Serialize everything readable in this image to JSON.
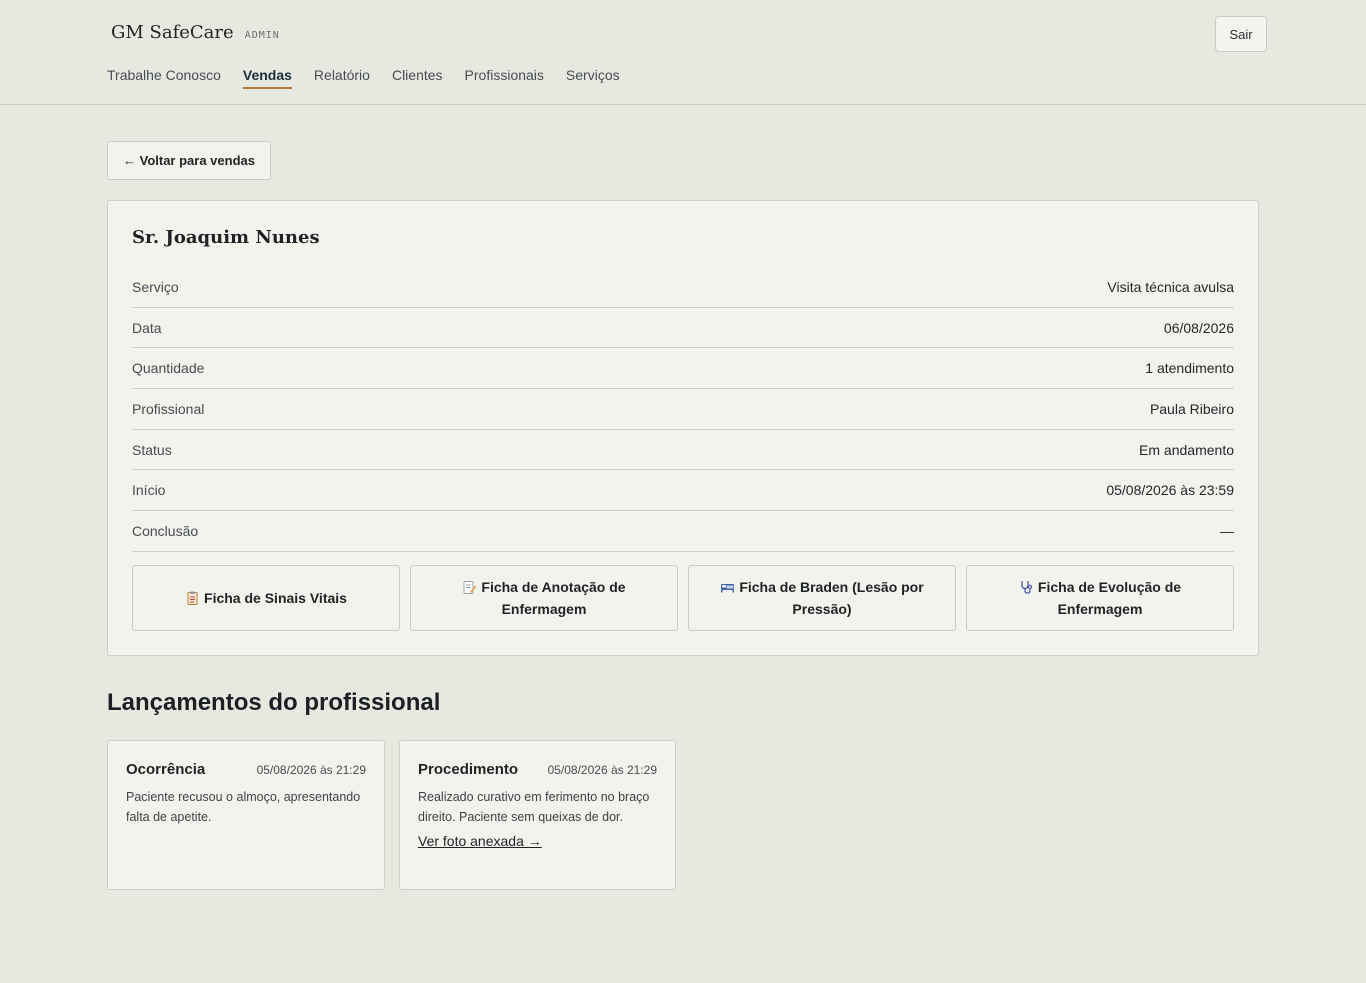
{
  "app": {
    "name": "GM SafeCare",
    "badge": "ADMIN",
    "logout_label": "Sair"
  },
  "nav": {
    "items": [
      {
        "label": "Trabalhe Conosco"
      },
      {
        "label": "Vendas"
      },
      {
        "label": "Relatório"
      },
      {
        "label": "Clientes"
      },
      {
        "label": "Profissionais"
      },
      {
        "label": "Serviços"
      }
    ],
    "active": "Vendas"
  },
  "back_label": "← Voltar para vendas",
  "sale": {
    "client_name": "Sr. Joaquim Nunes",
    "details": [
      {
        "label": "Serviço",
        "value": "Visita técnica avulsa"
      },
      {
        "label": "Data",
        "value": "06/08/2026"
      },
      {
        "label": "Quantidade",
        "value": "1 atendimento"
      },
      {
        "label": "Profissional",
        "value": "Paula Ribeiro"
      },
      {
        "label": "Status",
        "value": "Em andamento"
      },
      {
        "label": "Início",
        "value": "05/08/2026 às 23:59"
      },
      {
        "label": "Conclusão",
        "value": "—"
      }
    ],
    "forms": [
      {
        "label": "Ficha de Sinais Vitais",
        "icon": "clipboard-icon"
      },
      {
        "label": "Ficha de Anotação de Enfermagem",
        "icon": "memo-icon"
      },
      {
        "label": "Ficha de Braden (Lesão por Pressão)",
        "icon": "bed-icon"
      },
      {
        "label": "Ficha de Evolução de Enfermagem",
        "icon": "stethoscope-icon"
      }
    ]
  },
  "entries_section": {
    "title": "Lançamentos do profissional",
    "entries": [
      {
        "type": "Ocorrência",
        "date": "05/08/2026 às 21:29",
        "text": "Paciente recusou o almoço, apresentando falta de apetite."
      },
      {
        "type": "Procedimento",
        "date": "05/08/2026 às 21:29",
        "text": "Realizado curativo em ferimento no braço direito. Paciente sem queixas de dor.",
        "link": "Ver foto anexada →"
      }
    ]
  },
  "colors": {
    "background": "#e7e9e1",
    "card": "#f2f3ed",
    "accent": "#b07c3c"
  }
}
